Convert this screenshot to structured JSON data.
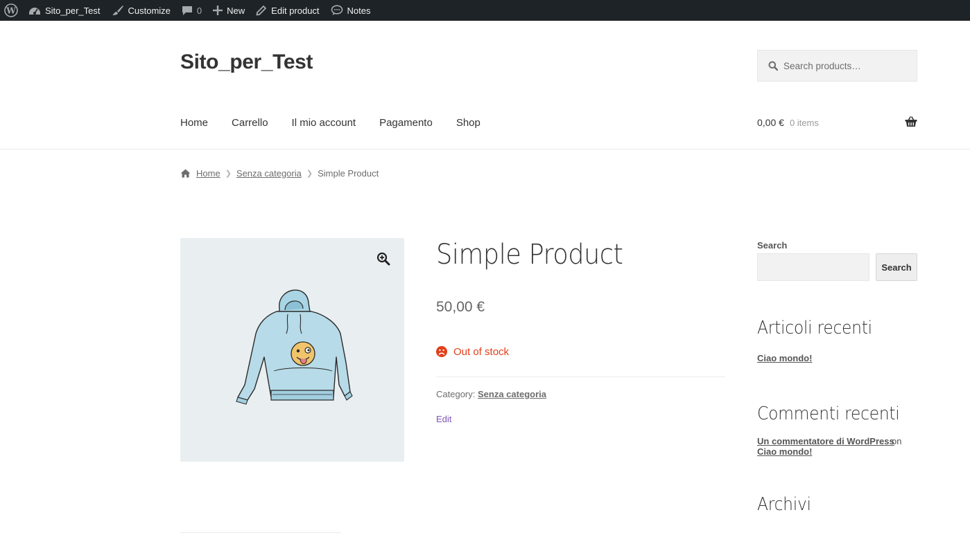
{
  "admin_bar": {
    "site_name": "Sito_per_Test",
    "customize": "Customize",
    "comments_count": "0",
    "new": "New",
    "edit_product": "Edit product",
    "notes": "Notes"
  },
  "header": {
    "site_title": "Sito_per_Test",
    "search_placeholder": "Search products…"
  },
  "nav": {
    "items": [
      "Home",
      "Carrello",
      "Il mio account",
      "Pagamento",
      "Shop"
    ]
  },
  "cart": {
    "amount": "0,00 €",
    "count": "0 items"
  },
  "breadcrumb": {
    "home": "Home",
    "category": "Senza categoria",
    "current": "Simple Product"
  },
  "product": {
    "title": "Simple Product",
    "price": "50,00 €",
    "stock_status": "Out of stock",
    "category_label": "Category:",
    "category": "Senza categoria",
    "edit": "Edit",
    "image_icon": "hoodie-image"
  },
  "sidebar": {
    "search_label": "Search",
    "search_button": "Search",
    "recent_posts_title": "Articoli recenti",
    "recent_post": "Ciao mondo!",
    "recent_comments_title": "Commenti recenti",
    "comment_author": "Un commentatore di WordPress",
    "comment_on": "on",
    "comment_post": "Ciao mondo!",
    "archives_title": "Archivi"
  },
  "colors": {
    "admin_bar": "#1d2327",
    "out_of_stock": "#e2401c",
    "edit_link": "#7f54b3",
    "gallery_bg": "#e9eef1"
  }
}
